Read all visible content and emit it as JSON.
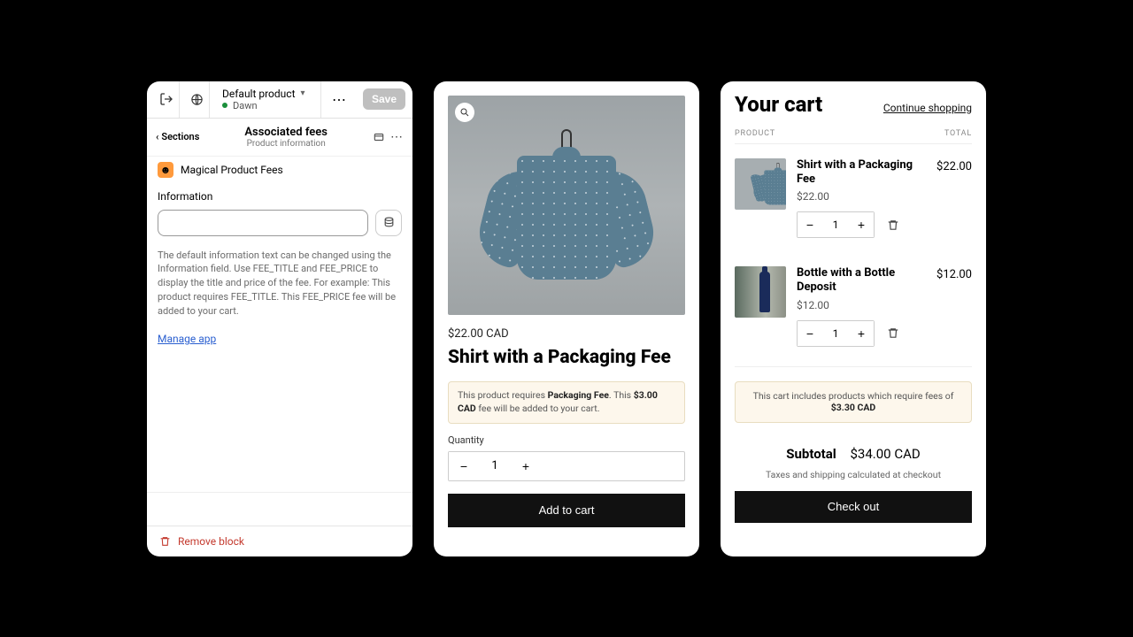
{
  "editor": {
    "product_selector": "Default product",
    "theme": "Dawn",
    "save_label": "Save",
    "back_label": "Sections",
    "header_title": "Associated fees",
    "header_subtitle": "Product information",
    "app_name": "Magical Product Fees",
    "info_label": "Information",
    "help_text": "The default information text can be changed using the Information field. Use FEE_TITLE and FEE_PRICE to display the title and price of the fee. For example: This product requires FEE_TITLE. This FEE_PRICE fee will be added to your cart.",
    "manage_link": "Manage app",
    "remove_label": "Remove block"
  },
  "product": {
    "price": "$22.00 CAD",
    "title": "Shirt with a Packaging Fee",
    "notice_pre": "This product requires ",
    "notice_fee": "Packaging Fee",
    "notice_mid": ". This ",
    "notice_price": "$3.00 CAD",
    "notice_post": " fee will be added to your cart.",
    "qty_label": "Quantity",
    "qty_value": "1",
    "add_label": "Add to cart"
  },
  "cart": {
    "title": "Your cart",
    "continue": "Continue shopping",
    "col_product": "PRODUCT",
    "col_total": "TOTAL",
    "items": [
      {
        "name": "Shirt with a Packaging Fee",
        "price": "$22.00",
        "qty": "1",
        "total": "$22.00"
      },
      {
        "name": "Bottle with a Bottle Deposit",
        "price": "$12.00",
        "qty": "1",
        "total": "$12.00"
      }
    ],
    "notice_pre": "This cart includes products which require fees of ",
    "notice_amount": "$3.30 CAD",
    "subtotal_label": "Subtotal",
    "subtotal_value": "$34.00 CAD",
    "tax_note": "Taxes and shipping calculated at checkout",
    "checkout_label": "Check out"
  }
}
